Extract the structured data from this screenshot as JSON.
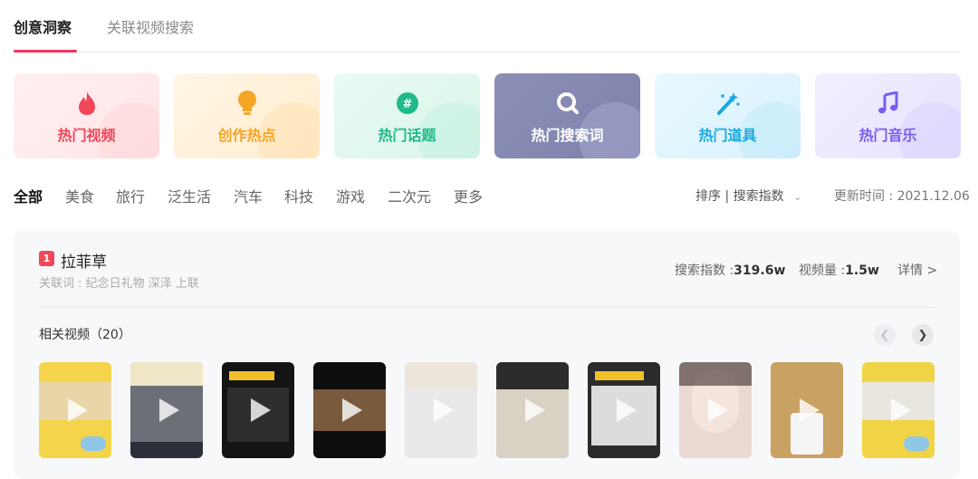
{
  "tabs": {
    "active": "创意洞察",
    "inactive": "关联视频搜索"
  },
  "cards": [
    {
      "label": "热门视频",
      "icon": "flame-icon",
      "color": "#f2465a"
    },
    {
      "label": "创作热点",
      "icon": "lightbulb-icon",
      "color": "#f5a524"
    },
    {
      "label": "热门话题",
      "icon": "hashtag-icon",
      "color": "#1fb98a"
    },
    {
      "label": "热门搜索词",
      "icon": "search-icon",
      "color": "#ffffff"
    },
    {
      "label": "热门道具",
      "icon": "magic-wand-icon",
      "color": "#18a9e0"
    },
    {
      "label": "热门音乐",
      "icon": "music-note-icon",
      "color": "#7a5cf0"
    }
  ],
  "filters": [
    "全部",
    "美食",
    "旅行",
    "泛生活",
    "汽车",
    "科技",
    "游戏",
    "二次元",
    "更多"
  ],
  "sort": {
    "prefix": "排序",
    "separator": "|",
    "value": "搜索指数"
  },
  "update_time": "更新时间 : 2021.12.06",
  "result": {
    "rank": "1",
    "keyword": "拉菲草",
    "related_words": "关联词 : 纪念日礼物 深泽 上联",
    "search_index_label": "搜索指数 :",
    "search_index_value": "319.6w",
    "video_count_label": "视频量 :",
    "video_count_value": "1.5w",
    "detail_label": "详情 >",
    "related_videos_title": "相关视频（20）"
  },
  "accent_color": "#f7335c"
}
